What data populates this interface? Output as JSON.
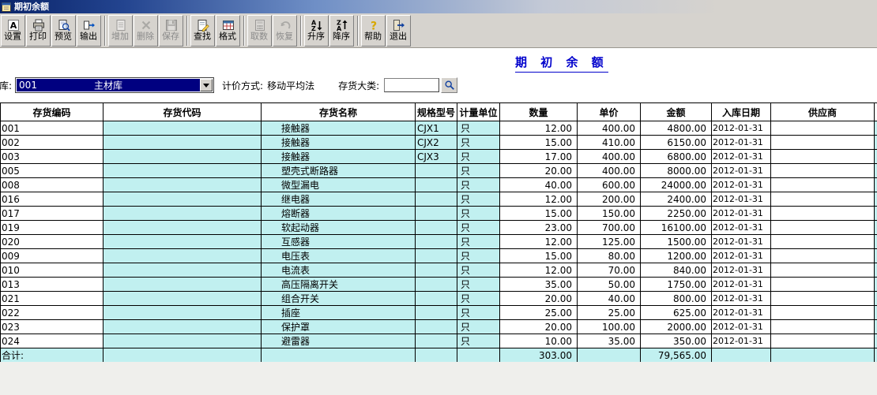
{
  "window": {
    "title": "期初余额"
  },
  "toolbar": {
    "buttons": [
      {
        "name": "settings-button",
        "label": "设置",
        "icon": "text-settings-icon",
        "enabled": true
      },
      {
        "name": "print-button",
        "label": "打印",
        "icon": "printer-icon",
        "enabled": true
      },
      {
        "name": "preview-button",
        "label": "预览",
        "icon": "print-preview-icon",
        "enabled": true
      },
      {
        "name": "export-button",
        "label": "输出",
        "icon": "export-icon",
        "enabled": true
      },
      {
        "name": "add-button",
        "label": "增加",
        "icon": "add-row-icon",
        "enabled": false,
        "group_start": true
      },
      {
        "name": "delete-button",
        "label": "删除",
        "icon": "delete-row-icon",
        "enabled": false
      },
      {
        "name": "save-button",
        "label": "保存",
        "icon": "save-icon",
        "enabled": false
      },
      {
        "name": "find-button",
        "label": "查找",
        "icon": "find-icon",
        "enabled": true,
        "group_start": true
      },
      {
        "name": "format-button",
        "label": "格式",
        "icon": "format-grid-icon",
        "enabled": true
      },
      {
        "name": "fetch-data-button",
        "label": "取数",
        "icon": "fetch-data-icon",
        "enabled": false,
        "group_start": true
      },
      {
        "name": "restore-button",
        "label": "恢复",
        "icon": "undo-icon",
        "enabled": false
      },
      {
        "name": "sort-asc-button",
        "label": "升序",
        "icon": "sort-ascending-icon",
        "enabled": true,
        "group_start": true
      },
      {
        "name": "sort-desc-button",
        "label": "降序",
        "icon": "sort-descending-icon",
        "enabled": true
      },
      {
        "name": "help-button",
        "label": "帮助",
        "icon": "help-icon",
        "enabled": true,
        "group_start": true
      },
      {
        "name": "exit-button",
        "label": "退出",
        "icon": "exit-icon",
        "enabled": true
      }
    ]
  },
  "page": {
    "title": "期 初 余 额"
  },
  "filters": {
    "warehouse_label": "仓库:",
    "warehouse_code": "001",
    "warehouse_name": "主材库",
    "pricing_label": "计价方式:",
    "pricing_value": "移动平均法",
    "category_label": "存货大类:",
    "category_value": ""
  },
  "table": {
    "headers": [
      "存货编码",
      "存货代码",
      "存货名称",
      "规格型号",
      "计量单位",
      "数量",
      "单价",
      "金额",
      "入库日期",
      "供应商"
    ],
    "rows": [
      [
        "001",
        "",
        "接触器",
        "CJX1",
        "只",
        "12.00",
        "400.00",
        "4800.00",
        "2012-01-31",
        ""
      ],
      [
        "002",
        "",
        "接触器",
        "CJX2",
        "只",
        "15.00",
        "410.00",
        "6150.00",
        "2012-01-31",
        ""
      ],
      [
        "003",
        "",
        "接触器",
        "CJX3",
        "只",
        "17.00",
        "400.00",
        "6800.00",
        "2012-01-31",
        ""
      ],
      [
        "005",
        "",
        "塑壳式断路器",
        "",
        "只",
        "20.00",
        "400.00",
        "8000.00",
        "2012-01-31",
        ""
      ],
      [
        "008",
        "",
        "微型漏电",
        "",
        "只",
        "40.00",
        "600.00",
        "24000.00",
        "2012-01-31",
        ""
      ],
      [
        "016",
        "",
        "继电器",
        "",
        "只",
        "12.00",
        "200.00",
        "2400.00",
        "2012-01-31",
        ""
      ],
      [
        "017",
        "",
        "熔断器",
        "",
        "只",
        "15.00",
        "150.00",
        "2250.00",
        "2012-01-31",
        ""
      ],
      [
        "019",
        "",
        "软起动器",
        "",
        "只",
        "23.00",
        "700.00",
        "16100.00",
        "2012-01-31",
        ""
      ],
      [
        "020",
        "",
        "互感器",
        "",
        "只",
        "12.00",
        "125.00",
        "1500.00",
        "2012-01-31",
        ""
      ],
      [
        "009",
        "",
        "电压表",
        "",
        "只",
        "15.00",
        "80.00",
        "1200.00",
        "2012-01-31",
        ""
      ],
      [
        "010",
        "",
        "电流表",
        "",
        "只",
        "12.00",
        "70.00",
        "840.00",
        "2012-01-31",
        ""
      ],
      [
        "013",
        "",
        "高压隔离开关",
        "",
        "只",
        "35.00",
        "50.00",
        "1750.00",
        "2012-01-31",
        ""
      ],
      [
        "021",
        "",
        "组合开关",
        "",
        "只",
        "20.00",
        "40.00",
        "800.00",
        "2012-01-31",
        ""
      ],
      [
        "022",
        "",
        "插座",
        "",
        "只",
        "25.00",
        "25.00",
        "625.00",
        "2012-01-31",
        ""
      ],
      [
        "023",
        "",
        "保护罩",
        "",
        "只",
        "20.00",
        "100.00",
        "2000.00",
        "2012-01-31",
        ""
      ],
      [
        "024",
        "",
        "避雷器",
        "",
        "只",
        "10.00",
        "35.00",
        "350.00",
        "2012-01-31",
        ""
      ]
    ],
    "total": {
      "label": "合计:",
      "quantity": "303.00",
      "amount": "79,565.00"
    }
  },
  "colors": {
    "accent_blue": "#0000cc",
    "selection_navy": "#000080",
    "cell_cyan": "#c1f0f0",
    "titlebar_blue": "#0a246a"
  }
}
